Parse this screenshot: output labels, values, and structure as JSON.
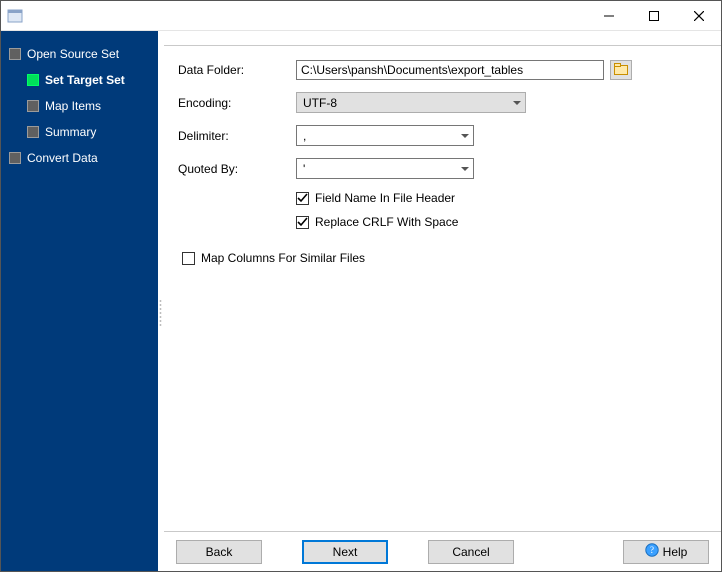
{
  "window": {
    "title": ""
  },
  "sidebar": {
    "items": [
      {
        "label": "Open Source Set"
      },
      {
        "label": "Set Target Set"
      },
      {
        "label": "Map Items"
      },
      {
        "label": "Summary"
      },
      {
        "label": "Convert Data"
      }
    ]
  },
  "form": {
    "data_folder_label": "Data Folder:",
    "data_folder_value": "C:\\Users\\pansh\\Documents\\export_tables",
    "encoding_label": "Encoding:",
    "encoding_value": "UTF-8",
    "delimiter_label": "Delimiter:",
    "delimiter_value": ",",
    "quoted_by_label": "Quoted By:",
    "quoted_by_value": "'",
    "field_name_header_label": "Field Name In File Header",
    "field_name_header_checked": true,
    "replace_crlf_label": "Replace CRLF With Space",
    "replace_crlf_checked": true,
    "map_columns_label": "Map Columns For Similar Files",
    "map_columns_checked": false
  },
  "buttons": {
    "back": "Back",
    "next": "Next",
    "cancel": "Cancel",
    "help": "Help"
  }
}
